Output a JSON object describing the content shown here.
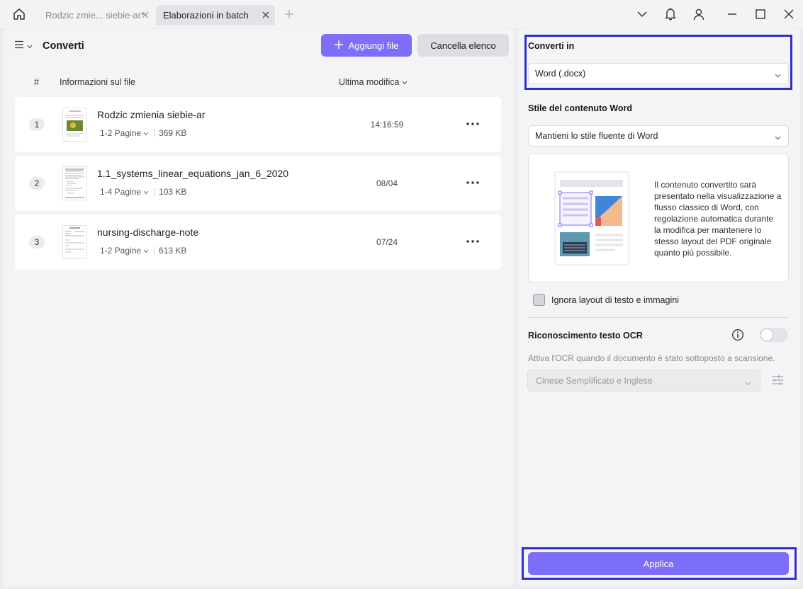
{
  "titlebar": {
    "tabs": [
      {
        "label": "Rodzic zmie... siebie-ar*",
        "active": false
      },
      {
        "label": "Elaborazioni in batch",
        "active": true
      }
    ]
  },
  "left": {
    "title": "Converti",
    "add_button": "Aggiungi file",
    "clear_button": "Cancella elenco",
    "columns": {
      "num": "#",
      "info": "Informazioni sul file",
      "modified": "Ultima modifica"
    },
    "files": [
      {
        "num": "1",
        "name": "Rodzic zmienia siebie-ar",
        "pages": "1-2 Pagine",
        "size": "369 KB",
        "date": "14:16:59"
      },
      {
        "num": "2",
        "name": "1.1_systems_linear_equations_jan_6_2020",
        "pages": "1-4 Pagine",
        "size": "103 KB",
        "date": "08/04"
      },
      {
        "num": "3",
        "name": "nursing-discharge-note",
        "pages": "1-2 Pagine",
        "size": "613 KB",
        "date": "07/24"
      }
    ]
  },
  "right": {
    "convert_label": "Converti in",
    "convert_value": "Word (.docx)",
    "style_label": "Stile del contenuto Word",
    "style_value": "Mantieni lo stile fluente di Word",
    "preview_text": "Il contenuto convertito sarà presentato nella visualizzazione a flusso classico di Word, con regolazione automatica durante la modifica per mantenere lo stesso layout del PDF originale quanto più possibile.",
    "ignore_layout_label": "Ignora layout di testo e immagini",
    "ocr_label": "Riconoscimento testo OCR",
    "ocr_hint": "Attiva l'OCR quando il documento è stato sottoposto a scansione.",
    "ocr_language": "Cinese Semplificato e Inglese",
    "apply_button": "Applica"
  },
  "colors": {
    "accent": "#7c6ef9",
    "highlight_border": "#2f2fcf"
  }
}
